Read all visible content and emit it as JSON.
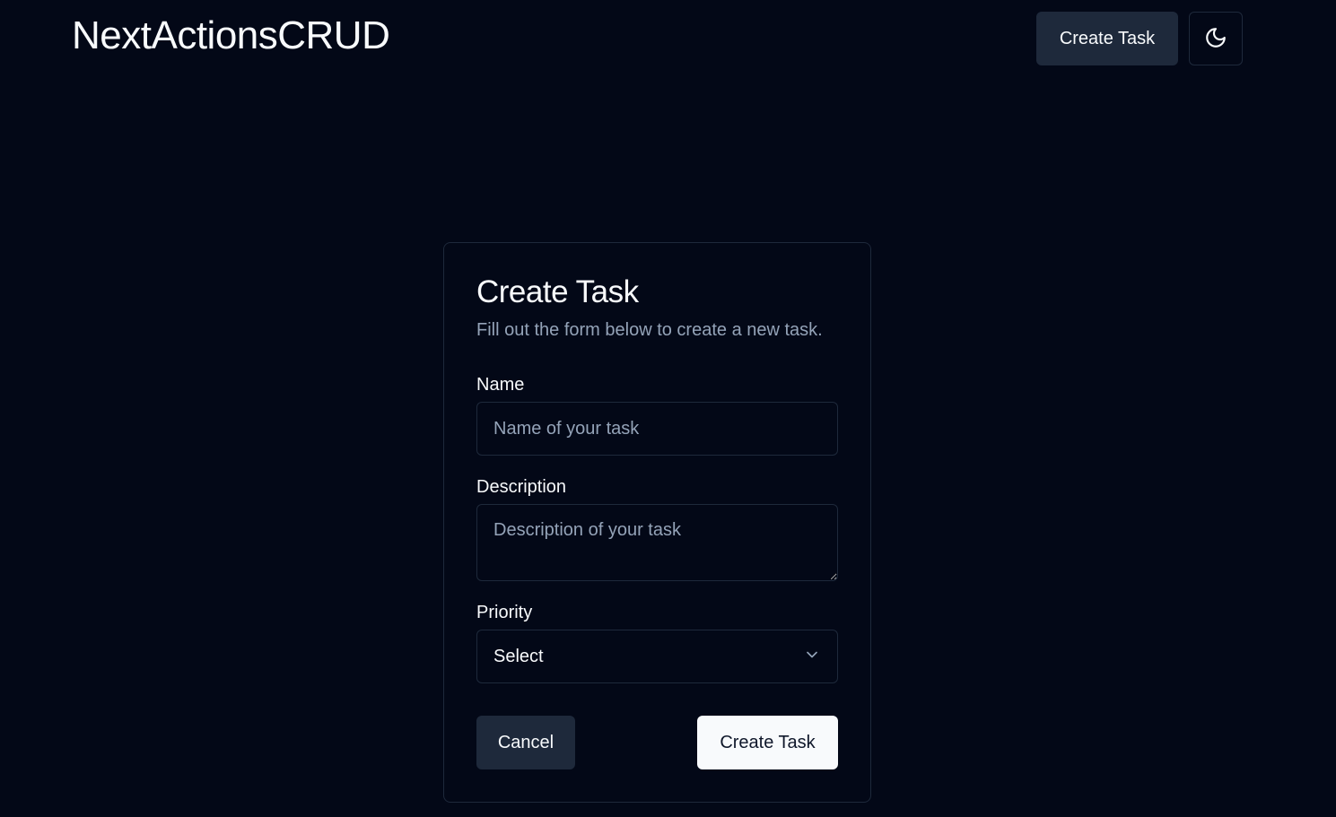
{
  "header": {
    "app_title": "NextActionsCRUD",
    "create_task_label": "Create Task",
    "theme_icon": "moon-icon"
  },
  "form": {
    "title": "Create Task",
    "subtitle": "Fill out the form below to create a new task.",
    "name": {
      "label": "Name",
      "placeholder": "Name of your task",
      "value": ""
    },
    "description": {
      "label": "Description",
      "placeholder": "Description of your task",
      "value": ""
    },
    "priority": {
      "label": "Priority",
      "selected": "Select",
      "icon": "chevron-down-icon"
    },
    "cancel_label": "Cancel",
    "submit_label": "Create Task"
  },
  "colors": {
    "background": "#030817",
    "border": "#1e293b",
    "secondary_button": "#1e293b",
    "primary_button": "#f8fafc",
    "muted_text": "#94a3b8",
    "foreground": "#f8fafc"
  }
}
